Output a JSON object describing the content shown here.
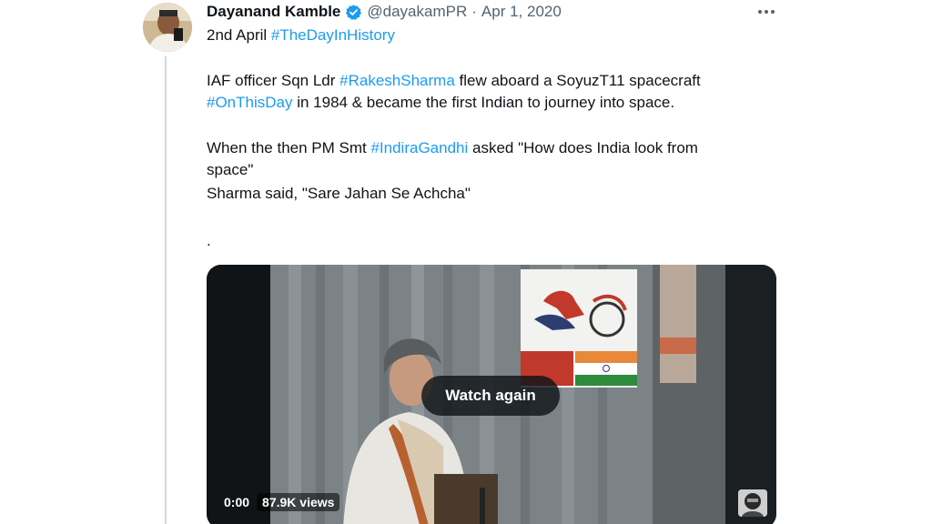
{
  "author": {
    "name": "Dayanand Kamble",
    "handle": "@dayakamPR",
    "separator": "·",
    "date": "Apr 1, 2020"
  },
  "tweet": {
    "line1_prefix": "2nd April ",
    "line1_tag": "#TheDayInHistory",
    "line2_prefix": "IAF officer Sqn Ldr ",
    "line2_tag": "#RakeshSharma",
    "line2_suffix": " flew aboard a SoyuzT11 spacecraft",
    "line3_tag": "#OnThisDay",
    "line3_suffix": " in 1984 & became the first Indian to journey into space.",
    "line4_prefix": "When the then PM Smt ",
    "line4_tag": "#IndiraGandhi",
    "line4_suffix": " asked \"How does India look from",
    "line5": "space\"",
    "line6": "Sharma said, \"Sare Jahan Se Achcha\"",
    "line7": "."
  },
  "video": {
    "watch_again": "Watch again",
    "time": "0:00",
    "views": "87.9K views"
  },
  "icons": {
    "verified": "verified-badge-icon",
    "more": "more-options-icon"
  },
  "colors": {
    "hashtag": "#1d9bf0",
    "secondary_text": "#536471",
    "verified": "#1d9bf0"
  }
}
